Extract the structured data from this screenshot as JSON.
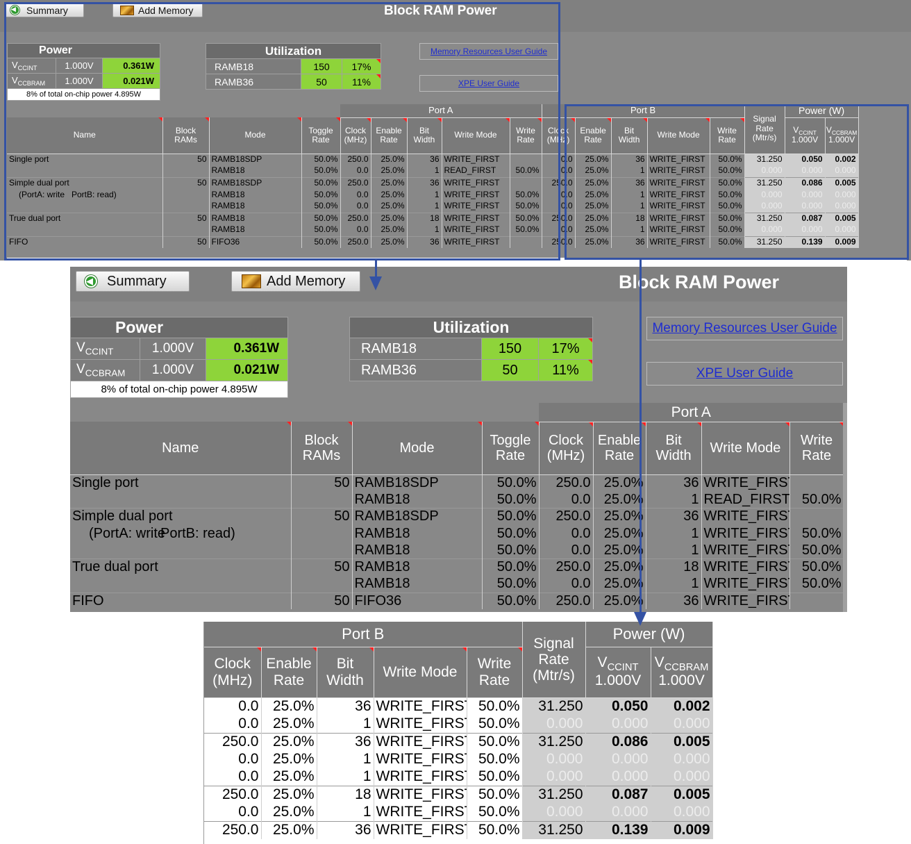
{
  "toolbar": {
    "summary_label": "Summary",
    "add_memory_label": "Add Memory",
    "title": "Block RAM Power"
  },
  "icons": {
    "summary": "green-circle-back-icon",
    "add_memory": "memory-chip-icon"
  },
  "power": {
    "heading": "Power",
    "rows": [
      {
        "rail_main": "V",
        "rail_sub": "CCINT",
        "voltage": "1.000V",
        "watts": "0.361W"
      },
      {
        "rail_main": "V",
        "rail_sub": "CCBRAM",
        "voltage": "1.000V",
        "watts": "0.021W"
      }
    ],
    "footer": "8% of total on-chip power 4.895W"
  },
  "utilization": {
    "heading": "Utilization",
    "rows": [
      {
        "name": "RAMB18",
        "count": "150",
        "pct": "17%"
      },
      {
        "name": "RAMB36",
        "count": "50",
        "pct": "11%"
      }
    ]
  },
  "links": {
    "memory_guide": "Memory Resources User Guide",
    "xpe_guide": "XPE User Guide"
  },
  "headers": {
    "port_a": "Port A",
    "port_b": "Port B",
    "power_w": "Power (W)",
    "name": "Name",
    "block_rams": [
      "Block",
      "RAMs"
    ],
    "mode": "Mode",
    "toggle_rate": [
      "Toggle",
      "Rate"
    ],
    "clock": [
      "Clock",
      "(MHz)"
    ],
    "enable": [
      "Enable",
      "Rate"
    ],
    "bit_width": [
      "Bit",
      "Width"
    ],
    "write_mode": "Write Mode",
    "write_rate": [
      "Write",
      "Rate"
    ],
    "signal_rate": [
      "Signal",
      "Rate",
      "(Mtr/s)"
    ],
    "vccint": {
      "main": "V",
      "sub": "CCINT",
      "volt": "1.000V"
    },
    "vccbram": {
      "main": "V",
      "sub": "CCBRAM",
      "volt": "1.000V"
    }
  },
  "rows": [
    {
      "name": "Single port",
      "blocks": "50",
      "mode": "RAMB18SDP",
      "toggle": "50.0%",
      "a_clock": "250.0",
      "a_enable": "25.0%",
      "a_bits": "36",
      "a_write_mode": "WRITE_FIRST",
      "a_write_rate": "",
      "b_clock": "0.0",
      "b_enable": "25.0%",
      "b_bits": "36",
      "b_write_mode": "WRITE_FIRST",
      "b_write_rate": "50.0%",
      "signal": "31.250",
      "vccint": "0.050",
      "vccbram": "0.002",
      "dim": false
    },
    {
      "name": "",
      "blocks": "",
      "mode": "RAMB18",
      "toggle": "50.0%",
      "a_clock": "0.0",
      "a_enable": "25.0%",
      "a_bits": "1",
      "a_write_mode": "READ_FIRST",
      "a_write_rate": "50.0%",
      "b_clock": "0.0",
      "b_enable": "25.0%",
      "b_bits": "1",
      "b_write_mode": "WRITE_FIRST",
      "b_write_rate": "50.0%",
      "signal": "0.000",
      "vccint": "0.000",
      "vccbram": "0.000",
      "dim": true
    },
    {
      "name": "Simple dual port",
      "blocks": "50",
      "mode": "RAMB18SDP",
      "toggle": "50.0%",
      "a_clock": "250.0",
      "a_enable": "25.0%",
      "a_bits": "36",
      "a_write_mode": "WRITE_FIRST",
      "a_write_rate": "",
      "b_clock": "250.0",
      "b_enable": "25.0%",
      "b_bits": "36",
      "b_write_mode": "WRITE_FIRST",
      "b_write_rate": "50.0%",
      "signal": "31.250",
      "vccint": "0.086",
      "vccbram": "0.005",
      "dim": false
    },
    {
      "name_a": "(PortA: write",
      "name_b": "PortB: read)",
      "blocks": "",
      "mode": "RAMB18",
      "toggle": "50.0%",
      "a_clock": "0.0",
      "a_enable": "25.0%",
      "a_bits": "1",
      "a_write_mode": "WRITE_FIRST",
      "a_write_rate": "50.0%",
      "b_clock": "0.0",
      "b_enable": "25.0%",
      "b_bits": "1",
      "b_write_mode": "WRITE_FIRST",
      "b_write_rate": "50.0%",
      "signal": "0.000",
      "vccint": "0.000",
      "vccbram": "0.000",
      "dim": true
    },
    {
      "name": "",
      "blocks": "",
      "mode": "RAMB18",
      "toggle": "50.0%",
      "a_clock": "0.0",
      "a_enable": "25.0%",
      "a_bits": "1",
      "a_write_mode": "WRITE_FIRST",
      "a_write_rate": "50.0%",
      "b_clock": "0.0",
      "b_enable": "25.0%",
      "b_bits": "1",
      "b_write_mode": "WRITE_FIRST",
      "b_write_rate": "50.0%",
      "signal": "0.000",
      "vccint": "0.000",
      "vccbram": "0.000",
      "dim": true
    },
    {
      "name": "True dual port",
      "blocks": "50",
      "mode": "RAMB18",
      "toggle": "50.0%",
      "a_clock": "250.0",
      "a_enable": "25.0%",
      "a_bits": "18",
      "a_write_mode": "WRITE_FIRST",
      "a_write_rate": "50.0%",
      "b_clock": "250.0",
      "b_enable": "25.0%",
      "b_bits": "18",
      "b_write_mode": "WRITE_FIRST",
      "b_write_rate": "50.0%",
      "signal": "31.250",
      "vccint": "0.087",
      "vccbram": "0.005",
      "dim": false
    },
    {
      "name": "",
      "blocks": "",
      "mode": "RAMB18",
      "toggle": "50.0%",
      "a_clock": "0.0",
      "a_enable": "25.0%",
      "a_bits": "1",
      "a_write_mode": "WRITE_FIRST",
      "a_write_rate": "50.0%",
      "b_clock": "0.0",
      "b_enable": "25.0%",
      "b_bits": "1",
      "b_write_mode": "WRITE_FIRST",
      "b_write_rate": "50.0%",
      "signal": "0.000",
      "vccint": "0.000",
      "vccbram": "0.000",
      "dim": true
    },
    {
      "name": "FIFO",
      "blocks": "50",
      "mode": "FIFO36",
      "toggle": "50.0%",
      "a_clock": "250.0",
      "a_enable": "25.0%",
      "a_bits": "36",
      "a_write_mode": "WRITE_FIRST",
      "a_write_rate": "",
      "b_clock": "250.0",
      "b_enable": "25.0%",
      "b_bits": "36",
      "b_write_mode": "WRITE_FIRST",
      "b_write_rate": "50.0%",
      "signal": "31.250",
      "vccint": "0.139",
      "vccbram": "0.009",
      "dim": false
    }
  ]
}
